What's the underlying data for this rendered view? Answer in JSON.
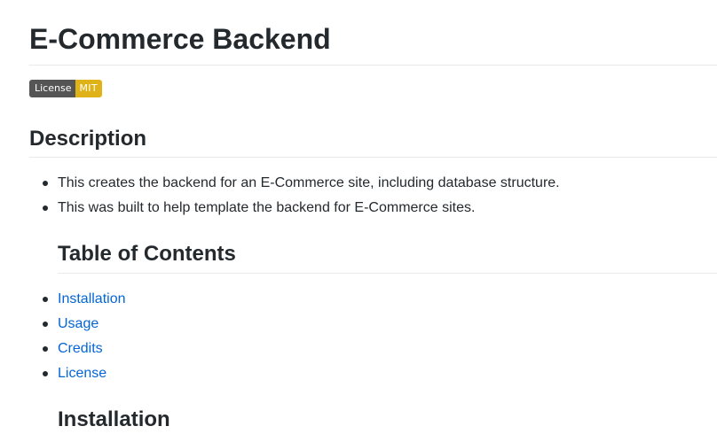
{
  "title": "E-Commerce Backend",
  "badge": {
    "label": "License",
    "value": "MIT",
    "label_color": "#555555",
    "value_color": "#dfb317"
  },
  "description": {
    "heading": "Description",
    "items": [
      "This creates the backend for an E-Commerce site, including database structure.",
      "This was built to help template the backend for E-Commerce sites."
    ]
  },
  "toc": {
    "heading": "Table of Contents",
    "links": [
      "Installation",
      "Usage",
      "Credits",
      "License"
    ]
  },
  "installation": {
    "heading": "Installation"
  },
  "colors": {
    "text": "#24292e",
    "link": "#0366d6",
    "rule": "#e8eaed"
  }
}
